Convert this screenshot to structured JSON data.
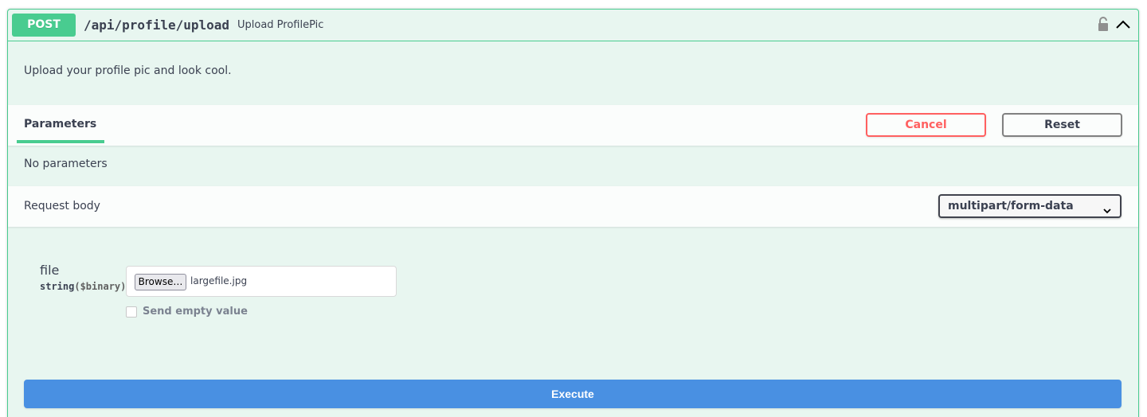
{
  "operation": {
    "method": "POST",
    "path": "/api/profile/upload",
    "summary": "Upload ProfilePic",
    "description": "Upload your profile pic and look cool."
  },
  "parameters": {
    "tab_label": "Parameters",
    "cancel_label": "Cancel",
    "reset_label": "Reset",
    "empty_text": "No parameters"
  },
  "request_body": {
    "label": "Request body",
    "content_type": "multipart/form-data",
    "field": {
      "name": "file",
      "type": "string",
      "format": "($binary)",
      "browse_label": "Browse…",
      "file_name": "largefile.jpg",
      "send_empty_label": "Send empty value"
    }
  },
  "execute_label": "Execute",
  "icons": {
    "lock": "lock-icon",
    "collapse": "chevron-up-icon",
    "select": "chevron-down-icon"
  },
  "colors": {
    "method": "#49cc90",
    "cancel": "#ff6060",
    "execute": "#4990e2"
  }
}
